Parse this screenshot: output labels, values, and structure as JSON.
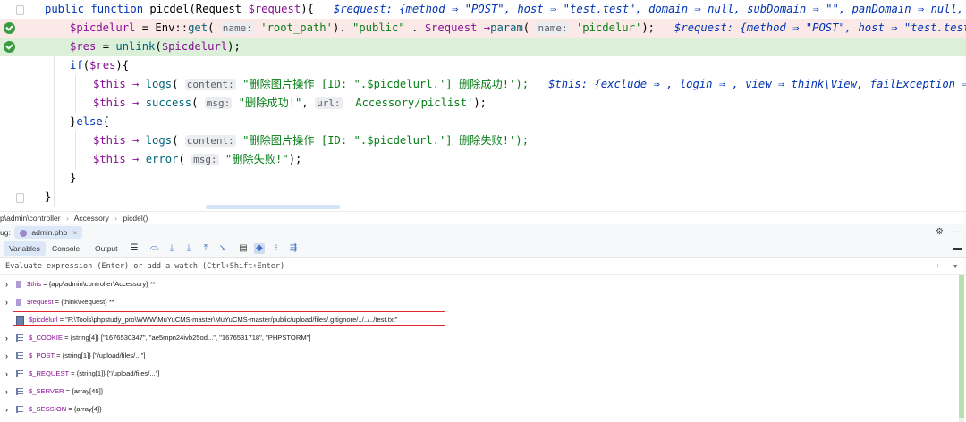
{
  "editor": {
    "lines": [
      {
        "kind": "plain",
        "parts": [
          {
            "c": "kw",
            "t": "public function "
          },
          {
            "c": "fn",
            "t": "picdel"
          },
          {
            "c": "cls",
            "t": "(Request "
          },
          {
            "c": "var",
            "t": "$request"
          },
          {
            "c": "cls",
            "t": "){   "
          },
          {
            "c": "cmt",
            "t": "$request: {method ⇒ \"POST\", host ⇒ \"test.test\", domain ⇒ null, subDomain ⇒ \"\", panDomain ⇒ null, url ⇒ \"/a"
          }
        ]
      },
      {
        "kind": "red",
        "parts": [
          {
            "c": "var",
            "t": "$picdelurl"
          },
          {
            "c": "cls",
            "t": " = "
          },
          {
            "c": "cls",
            "t": "Env"
          },
          {
            "c": "cls",
            "t": "::"
          },
          {
            "c": "meth",
            "t": "get"
          },
          {
            "c": "cls",
            "t": "( "
          },
          {
            "c": "hint",
            "t": "name:"
          },
          {
            "c": "str",
            "t": " 'root_path'"
          },
          {
            "c": "cls",
            "t": "). "
          },
          {
            "c": "str",
            "t": "\"public\""
          },
          {
            "c": "cls",
            "t": " . "
          },
          {
            "c": "var",
            "t": "$request"
          },
          {
            "c": "arrow",
            "t": " →"
          },
          {
            "c": "meth",
            "t": "param"
          },
          {
            "c": "cls",
            "t": "( "
          },
          {
            "c": "hint",
            "t": "name:"
          },
          {
            "c": "str",
            "t": " 'picdelur'"
          },
          {
            "c": "cls",
            "t": ");   "
          },
          {
            "c": "cmt",
            "t": "$request: {method ⇒ \"POST\", host ⇒ \"test.test\", domain ⇒ null, subDomain ⇒ \"\", panDomain ⇒ null, url ⇒ \"/a"
          }
        ]
      },
      {
        "kind": "green",
        "parts": [
          {
            "c": "var",
            "t": "$res"
          },
          {
            "c": "cls",
            "t": " = "
          },
          {
            "c": "meth",
            "t": "unlink"
          },
          {
            "c": "cls",
            "t": "("
          },
          {
            "c": "var",
            "t": "$picdelurl"
          },
          {
            "c": "cls",
            "t": ");"
          }
        ]
      },
      {
        "kind": "plain",
        "parts": [
          {
            "c": "kw",
            "t": "if"
          },
          {
            "c": "cls",
            "t": "("
          },
          {
            "c": "var",
            "t": "$res"
          },
          {
            "c": "cls",
            "t": "){"
          }
        ]
      },
      {
        "kind": "plain",
        "parts": [
          {
            "c": "var",
            "t": "$this"
          },
          {
            "c": "arrow",
            "t": " → "
          },
          {
            "c": "meth",
            "t": "logs"
          },
          {
            "c": "cls",
            "t": "( "
          },
          {
            "c": "hint",
            "t": "content:"
          },
          {
            "c": "str",
            "t": " \"删除图片操作 [ID: \".$picdelurl.'] 删除成功!');"
          },
          {
            "c": "cls",
            "t": "   "
          },
          {
            "c": "cmt",
            "t": "$this: {exclude ⇒ , login ⇒ , view ⇒ think\\View, failException ⇒ false, batc"
          }
        ]
      },
      {
        "kind": "plain",
        "parts": [
          {
            "c": "var",
            "t": "$this"
          },
          {
            "c": "arrow",
            "t": " → "
          },
          {
            "c": "meth",
            "t": "success"
          },
          {
            "c": "cls",
            "t": "( "
          },
          {
            "c": "hint",
            "t": "msg:"
          },
          {
            "c": "str",
            "t": " \"删除成功!\""
          },
          {
            "c": "cls",
            "t": ", "
          },
          {
            "c": "hint",
            "t": "url:"
          },
          {
            "c": "str",
            "t": " 'Accessory/piclist'"
          },
          {
            "c": "cls",
            "t": ");"
          }
        ]
      },
      {
        "kind": "plain",
        "parts": [
          {
            "c": "cls",
            "t": "}"
          },
          {
            "c": "kw",
            "t": "else"
          },
          {
            "c": "cls",
            "t": "{"
          }
        ]
      },
      {
        "kind": "plain",
        "parts": [
          {
            "c": "var",
            "t": "$this"
          },
          {
            "c": "arrow",
            "t": " → "
          },
          {
            "c": "meth",
            "t": "logs"
          },
          {
            "c": "cls",
            "t": "( "
          },
          {
            "c": "hint",
            "t": "content:"
          },
          {
            "c": "str",
            "t": " \"删除图片操作 [ID: \".$picdelurl.'] 删除失败!');"
          }
        ]
      },
      {
        "kind": "plain",
        "parts": [
          {
            "c": "var",
            "t": "$this"
          },
          {
            "c": "arrow",
            "t": " → "
          },
          {
            "c": "meth",
            "t": "error"
          },
          {
            "c": "cls",
            "t": "( "
          },
          {
            "c": "hint",
            "t": "msg:"
          },
          {
            "c": "str",
            "t": " \"删除失败!\""
          },
          {
            "c": "cls",
            "t": ");"
          }
        ]
      },
      {
        "kind": "plain",
        "parts": [
          {
            "c": "cls",
            "t": "}"
          }
        ]
      },
      {
        "kind": "plain",
        "parts": [
          {
            "c": "cls",
            "t": "}"
          }
        ]
      }
    ]
  },
  "breadcrumb": {
    "items": [
      "p\\admin\\controller",
      "Accessory",
      "picdel()"
    ],
    "sep": "›"
  },
  "debug": {
    "label": "ug:",
    "file_tab": "admin.php",
    "close": "×"
  },
  "tabs": {
    "variables": "Variables",
    "console": "Console",
    "output": "Output"
  },
  "eval": {
    "placeholder": "Evaluate expression (Enter) or add a watch (Ctrl+Shift+Enter)"
  },
  "variables": [
    {
      "name": "$this",
      "value": " = {app\\admin\\controller\\Accessory} **",
      "expandable": true,
      "kind": "obj"
    },
    {
      "name": "$request",
      "value": " = {think\\Request} **",
      "expandable": true,
      "kind": "obj"
    },
    {
      "name": "$picdelurl",
      "value": " = \"F:\\Tools\\phpstudy_pro\\WWW\\MuYuCMS-master\\MuYuCMS-master/public/upload/files/.gitignore/../../../test.txt\"",
      "expandable": false,
      "kind": "str"
    },
    {
      "name": "$_COOKIE",
      "value": " = {string[4]} [\"1676530347\", \"ae5mpn24ivb25od...\", \"1676531718\", \"PHPSTORM\"]",
      "expandable": true,
      "kind": "arr"
    },
    {
      "name": "$_POST",
      "value": " = {string[1]} [\"/upload/files/...\"]",
      "expandable": true,
      "kind": "arr"
    },
    {
      "name": "$_REQUEST",
      "value": " = {string[1]} [\"/upload/files/...\"]",
      "expandable": true,
      "kind": "arr"
    },
    {
      "name": "$_SERVER",
      "value": " = {array[45]}",
      "expandable": true,
      "kind": "arr"
    },
    {
      "name": "$_SESSION",
      "value": " = {array[4]}",
      "expandable": true,
      "kind": "arr"
    }
  ],
  "colors": {
    "accent": "#3d72c4",
    "highlight_red": "#fbe9e7",
    "highlight_green": "#dcefd9",
    "outline": "#e0262e"
  }
}
